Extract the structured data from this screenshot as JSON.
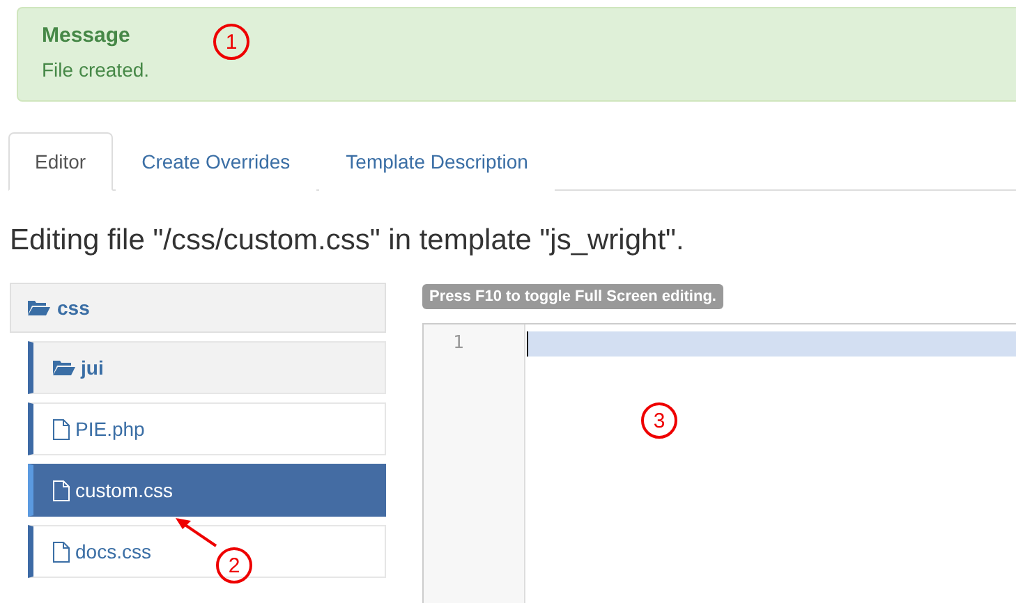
{
  "message": {
    "title": "Message",
    "text": "File created."
  },
  "tabs": [
    {
      "label": "Editor",
      "selected": true
    },
    {
      "label": "Create Overrides",
      "selected": false
    },
    {
      "label": "Template Description",
      "selected": false
    }
  ],
  "heading": "Editing file \"/css/custom.css\" in template \"js_wright\".",
  "tree": {
    "label": "css",
    "kind": "folder",
    "children": [
      {
        "label": "jui",
        "kind": "folder",
        "selected": false
      },
      {
        "label": "PIE.php",
        "kind": "file",
        "selected": false
      },
      {
        "label": "custom.css",
        "kind": "file",
        "selected": true
      },
      {
        "label": "docs.css",
        "kind": "file",
        "selected": false
      }
    ]
  },
  "editor": {
    "hint": "Press F10 to toggle Full Screen editing.",
    "line_numbers": [
      "1"
    ]
  },
  "callouts": [
    {
      "label": "1"
    },
    {
      "label": "2"
    },
    {
      "label": "3"
    }
  ]
}
